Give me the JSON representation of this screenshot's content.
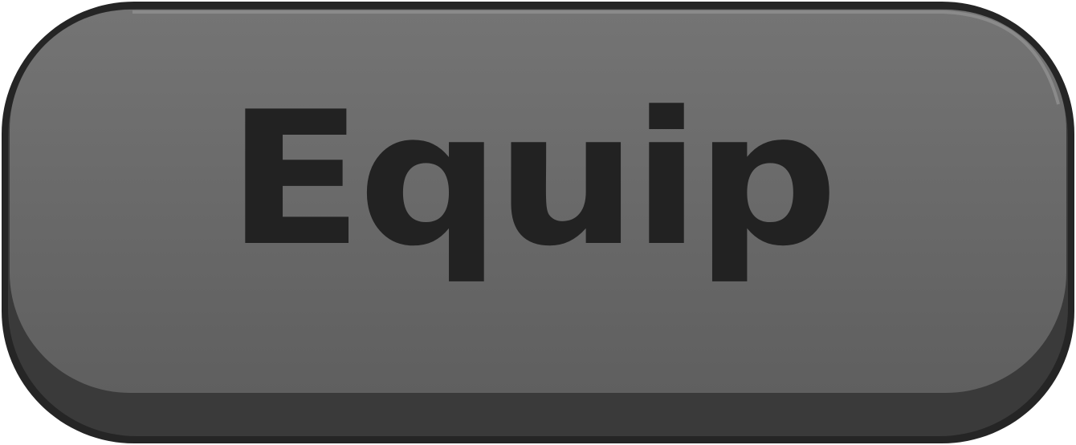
{
  "button": {
    "label": "Equip",
    "colors": {
      "face": "#707070",
      "face_bottom": "#5f5f5f",
      "rim": "#3a3a3a",
      "outline": "#252525",
      "text": "#222222"
    }
  }
}
